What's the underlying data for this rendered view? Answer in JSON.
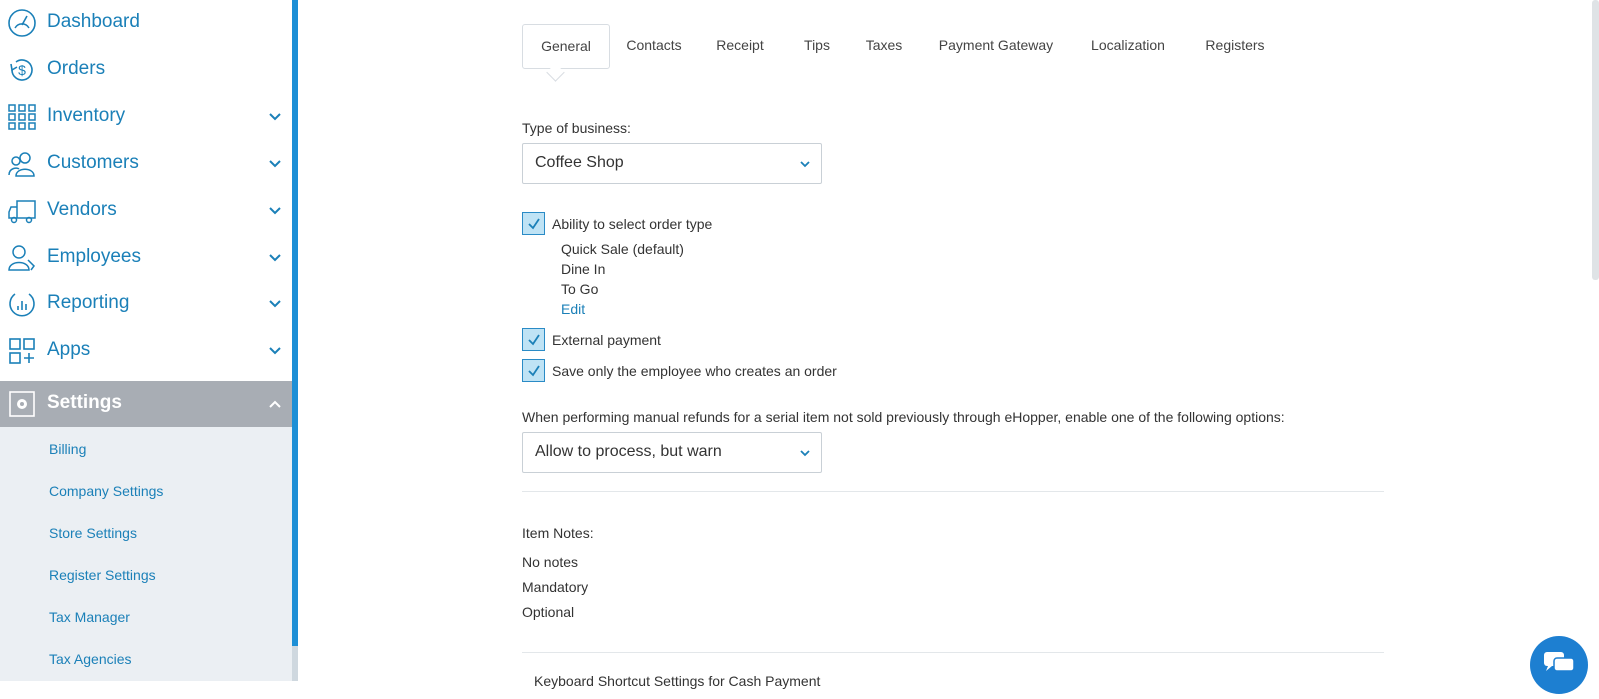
{
  "sidebar": {
    "items": [
      {
        "label": "Dashboard",
        "icon": "speedometer-icon"
      },
      {
        "label": "Orders",
        "icon": "dollar-refresh-icon"
      },
      {
        "label": "Inventory",
        "icon": "grid-icon"
      },
      {
        "label": "Customers",
        "icon": "users-icon"
      },
      {
        "label": "Vendors",
        "icon": "truck-icon"
      },
      {
        "label": "Employees",
        "icon": "employee-icon"
      },
      {
        "label": "Reporting",
        "icon": "chart-icon"
      },
      {
        "label": "Apps",
        "icon": "apps-icon"
      },
      {
        "label": "Settings",
        "icon": "gear-icon"
      }
    ],
    "sub_items": [
      "Billing",
      "Company Settings",
      "Store Settings",
      "Register Settings",
      "Tax Manager",
      "Tax Agencies"
    ]
  },
  "tabs": [
    "General",
    "Contacts",
    "Receipt",
    "Tips",
    "Taxes",
    "Payment Gateway",
    "Localization",
    "Registers"
  ],
  "form": {
    "business_type_label": "Type of business:",
    "business_type_value": "Coffee Shop",
    "order_type_label": "Ability to select order type",
    "order_types": [
      "Quick Sale (default)",
      "Dine In",
      "To Go"
    ],
    "edit_link": "Edit",
    "external_payment_label": "External payment",
    "save_employee_label": "Save only the employee who creates an order",
    "refund_label": "When performing manual refunds for a serial item not sold previously through eHopper, enable one of the following options:",
    "refund_value": "Allow to process, but warn",
    "item_notes_label": "Item Notes:",
    "item_notes_options": [
      "No notes",
      "Mandatory",
      "Optional"
    ],
    "keyboard_section": "Keyboard Shortcut Settings for Cash Payment"
  },
  "colors": {
    "accent": "#1b80b8",
    "sidebar_active": "#a8adb4",
    "submenu_bg": "#ebeff3",
    "checkbox_fill": "#bfe3f5"
  }
}
